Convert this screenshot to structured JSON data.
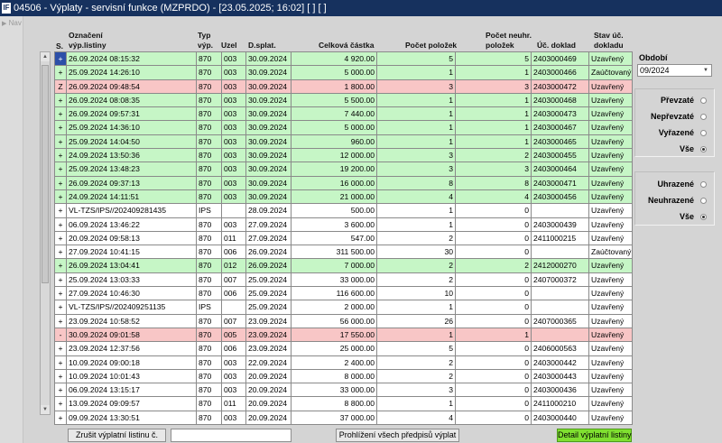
{
  "window": {
    "title": "04506 - Výplaty - servisní funkce (MZPRDO) - [23.05.2025; 16:02]  [ ]  [ ]",
    "app_icon": "IF"
  },
  "nav": {
    "label": "Nav"
  },
  "columns": {
    "status": "S.",
    "name_l1": "Označení",
    "name_l2": "výp.listiny",
    "type_l1": "Typ",
    "type_l2": "výp.",
    "uzel": "Uzel",
    "due": "D.splat.",
    "amount": "Celková částka",
    "items": "Počet položek",
    "unpaid_l1": "Počet neuhr.",
    "unpaid_l2": "položek",
    "doc": "Úč. doklad",
    "state_l1": "Stav úč.",
    "state_l2": "dokladu"
  },
  "rows": [
    {
      "s": "+",
      "name": "26.09.2024 08:15:32",
      "typ": "870",
      "uzel": "003",
      "due": "30.09.2024",
      "amount": "4 920.00",
      "items": "5",
      "unpaid": "5",
      "doc": "2403000469",
      "state": "Uzavřený",
      "color": "green"
    },
    {
      "s": "+",
      "name": "25.09.2024 14:26:10",
      "typ": "870",
      "uzel": "003",
      "due": "30.09.2024",
      "amount": "5 000.00",
      "items": "1",
      "unpaid": "1",
      "doc": "2403000466",
      "state": "Zaúčtovaný",
      "color": "green"
    },
    {
      "s": "Z",
      "name": "26.09.2024 09:48:54",
      "typ": "870",
      "uzel": "003",
      "due": "30.09.2024",
      "amount": "1 800.00",
      "items": "3",
      "unpaid": "3",
      "doc": "2403000472",
      "state": "Uzavřený",
      "color": "red"
    },
    {
      "s": "+",
      "name": "26.09.2024 08:08:35",
      "typ": "870",
      "uzel": "003",
      "due": "30.09.2024",
      "amount": "5 500.00",
      "items": "1",
      "unpaid": "1",
      "doc": "2403000468",
      "state": "Uzavřený",
      "color": "green"
    },
    {
      "s": "+",
      "name": "26.09.2024 09:57:31",
      "typ": "870",
      "uzel": "003",
      "due": "30.09.2024",
      "amount": "7 440.00",
      "items": "1",
      "unpaid": "1",
      "doc": "2403000473",
      "state": "Uzavřený",
      "color": "green"
    },
    {
      "s": "+",
      "name": "25.09.2024 14:36:10",
      "typ": "870",
      "uzel": "003",
      "due": "30.09.2024",
      "amount": "5 000.00",
      "items": "1",
      "unpaid": "1",
      "doc": "2403000467",
      "state": "Uzavřený",
      "color": "green"
    },
    {
      "s": "+",
      "name": "25.09.2024 14:04:50",
      "typ": "870",
      "uzel": "003",
      "due": "30.09.2024",
      "amount": "960.00",
      "items": "1",
      "unpaid": "1",
      "doc": "2403000465",
      "state": "Uzavřený",
      "color": "green"
    },
    {
      "s": "+",
      "name": "24.09.2024 13:50:36",
      "typ": "870",
      "uzel": "003",
      "due": "30.09.2024",
      "amount": "12 000.00",
      "items": "3",
      "unpaid": "2",
      "doc": "2403000455",
      "state": "Uzavřený",
      "color": "green"
    },
    {
      "s": "+",
      "name": "25.09.2024 13:48:23",
      "typ": "870",
      "uzel": "003",
      "due": "30.09.2024",
      "amount": "19 200.00",
      "items": "3",
      "unpaid": "3",
      "doc": "2403000464",
      "state": "Uzavřený",
      "color": "green"
    },
    {
      "s": "+",
      "name": "26.09.2024 09:37:13",
      "typ": "870",
      "uzel": "003",
      "due": "30.09.2024",
      "amount": "16 000.00",
      "items": "8",
      "unpaid": "8",
      "doc": "2403000471",
      "state": "Uzavřený",
      "color": "green"
    },
    {
      "s": "+",
      "name": "24.09.2024 14:11:51",
      "typ": "870",
      "uzel": "003",
      "due": "30.09.2024",
      "amount": "21 000.00",
      "items": "4",
      "unpaid": "4",
      "doc": "2403000456",
      "state": "Uzavřený",
      "color": "green"
    },
    {
      "s": "+",
      "name": "VL-TZS/IPS//202409281435",
      "typ": "IPS",
      "uzel": "",
      "due": "28.09.2024",
      "amount": "500.00",
      "items": "1",
      "unpaid": "0",
      "doc": "",
      "state": "Uzavřený",
      "color": "white"
    },
    {
      "s": "+",
      "name": "06.09.2024 13:46:22",
      "typ": "870",
      "uzel": "003",
      "due": "27.09.2024",
      "amount": "3 600.00",
      "items": "1",
      "unpaid": "0",
      "doc": "2403000439",
      "state": "Uzavřený",
      "color": "white"
    },
    {
      "s": "+",
      "name": "20.09.2024 09:58:13",
      "typ": "870",
      "uzel": "011",
      "due": "27.09.2024",
      "amount": "547.00",
      "items": "2",
      "unpaid": "0",
      "doc": "2411000215",
      "state": "Uzavřený",
      "color": "white"
    },
    {
      "s": "+",
      "name": "27.09.2024 10:41:15",
      "typ": "870",
      "uzel": "006",
      "due": "26.09.2024",
      "amount": "311 500.00",
      "items": "30",
      "unpaid": "0",
      "doc": "",
      "state": "Zaúčtovaný",
      "color": "white"
    },
    {
      "s": "+",
      "name": "26.09.2024 13:04:41",
      "typ": "870",
      "uzel": "012",
      "due": "26.09.2024",
      "amount": "7 000.00",
      "items": "2",
      "unpaid": "2",
      "doc": "2412000270",
      "state": "Uzavřený",
      "color": "green"
    },
    {
      "s": "+",
      "name": "25.09.2024 13:03:33",
      "typ": "870",
      "uzel": "007",
      "due": "25.09.2024",
      "amount": "33 000.00",
      "items": "2",
      "unpaid": "0",
      "doc": "2407000372",
      "state": "Uzavřený",
      "color": "white"
    },
    {
      "s": "+",
      "name": "27.09.2024 10:46:30",
      "typ": "870",
      "uzel": "006",
      "due": "25.09.2024",
      "amount": "116 600.00",
      "items": "10",
      "unpaid": "0",
      "doc": "",
      "state": "Uzavřený",
      "color": "white"
    },
    {
      "s": "+",
      "name": "VL-TZS/IPS//202409251135",
      "typ": "IPS",
      "uzel": "",
      "due": "25.09.2024",
      "amount": "2 000.00",
      "items": "1",
      "unpaid": "0",
      "doc": "",
      "state": "Uzavřený",
      "color": "white"
    },
    {
      "s": "+",
      "name": "23.09.2024 10:58:52",
      "typ": "870",
      "uzel": "007",
      "due": "23.09.2024",
      "amount": "56 000.00",
      "items": "26",
      "unpaid": "0",
      "doc": "2407000365",
      "state": "Uzavřený",
      "color": "white"
    },
    {
      "s": "-",
      "name": "30.09.2024 09:01:58",
      "typ": "870",
      "uzel": "005",
      "due": "23.09.2024",
      "amount": "17 550.00",
      "items": "1",
      "unpaid": "1",
      "doc": "",
      "state": "Uzavřený",
      "color": "red"
    },
    {
      "s": "+",
      "name": "23.09.2024 12:37:56",
      "typ": "870",
      "uzel": "006",
      "due": "23.09.2024",
      "amount": "25 000.00",
      "items": "5",
      "unpaid": "0",
      "doc": "2406000563",
      "state": "Uzavřený",
      "color": "white"
    },
    {
      "s": "+",
      "name": "10.09.2024 09:00:18",
      "typ": "870",
      "uzel": "003",
      "due": "22.09.2024",
      "amount": "2 400.00",
      "items": "2",
      "unpaid": "0",
      "doc": "2403000442",
      "state": "Uzavřený",
      "color": "white"
    },
    {
      "s": "+",
      "name": "10.09.2024 10:01:43",
      "typ": "870",
      "uzel": "003",
      "due": "20.09.2024",
      "amount": "8 000.00",
      "items": "2",
      "unpaid": "0",
      "doc": "2403000443",
      "state": "Uzavřený",
      "color": "white"
    },
    {
      "s": "+",
      "name": "06.09.2024 13:15:17",
      "typ": "870",
      "uzel": "003",
      "due": "20.09.2024",
      "amount": "33 000.00",
      "items": "3",
      "unpaid": "0",
      "doc": "2403000436",
      "state": "Uzavřený",
      "color": "white"
    },
    {
      "s": "+",
      "name": "13.09.2024 09:09:57",
      "typ": "870",
      "uzel": "011",
      "due": "20.09.2024",
      "amount": "8 800.00",
      "items": "1",
      "unpaid": "0",
      "doc": "2411000210",
      "state": "Uzavřený",
      "color": "white"
    },
    {
      "s": "+",
      "name": "09.09.2024 13:30:51",
      "typ": "870",
      "uzel": "003",
      "due": "20.09.2024",
      "amount": "37 000.00",
      "items": "4",
      "unpaid": "0",
      "doc": "2403000440",
      "state": "Uzavřený",
      "color": "white"
    }
  ],
  "sidebar": {
    "obdobi_label": "Období",
    "obdobi_value": "09/2024",
    "group1": [
      {
        "label": "Převzaté",
        "selected": false
      },
      {
        "label": "Nepřevzaté",
        "selected": false
      },
      {
        "label": "Vyřazené",
        "selected": false
      },
      {
        "label": "Vše",
        "selected": true
      }
    ],
    "group2": [
      {
        "label": "Uhrazené",
        "selected": false
      },
      {
        "label": "Neuhrazené",
        "selected": false
      },
      {
        "label": "Vše",
        "selected": true
      }
    ]
  },
  "buttons": {
    "cancel": "Zrušit výplatní listinu č.",
    "input_value": "",
    "review": "Prohlížení všech předpisů výplat",
    "detail": "Detail výplatní listiny"
  },
  "colors": {
    "green_row": "#c6f6c6",
    "red_row": "#f8c6c6",
    "titlebar": "#16315e",
    "detail_button": "#7fe030"
  }
}
